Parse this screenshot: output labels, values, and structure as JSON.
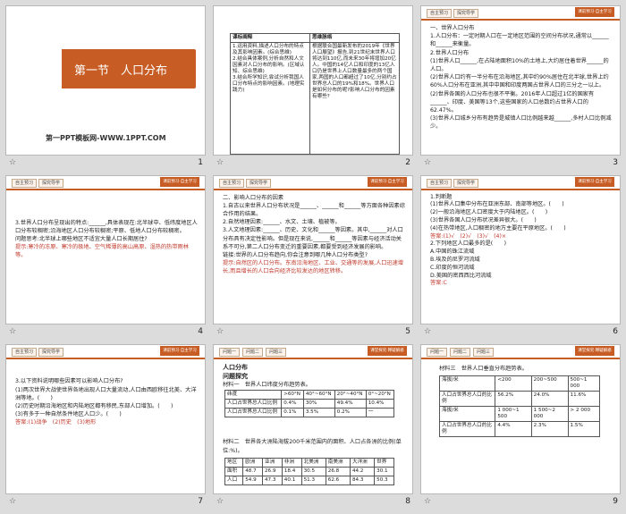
{
  "slides": [
    {
      "num": "1",
      "title": "第一节　人口分布",
      "footer": "第一PPT模板网-WWW.1PPT.COM",
      "accent": "#c75c24"
    },
    {
      "num": "2",
      "col1_head": "课标阐释",
      "col1": "1.运用资料,描述人口分布的特点及其影响因素。(综合思维)\n2.结合具体案例,分析自然和人文因素对人口分布的影响。(区域认知、综合思维)\n3.结合所学知识,尝试分析我国人口分布特点的影响因素。(地理实践力)",
      "col2_head": "思维脉络",
      "col2": "根据联合国最新发布的2019年《世界人口展望》报告,到21世纪末世界人口将达到110亿,而未来30年将增加20亿人。中国的14亿人口和印度的13亿人口仍是世界上人口数量最多的两个国家,两国的人口都超过了10亿,分别约占世界总人口的19%和18%。世界人口是如何分布的呢?影响人口分布的因素有哪些?"
    },
    {
      "num": "3",
      "chips": [
        "自主预习",
        "探究导学"
      ],
      "logo": "课前预习·自主学习",
      "lines": [
        "一、世界人口分布",
        "1.人口分布：一定时期人口在一定地区范围的空间分布状况,通常以______和______来衡量。",
        "2.世界人口分布",
        "(1)世界人口______,在占陆地面积10%的土地上,大约居住着世界______的人口。",
        "(2)世界人口约有一半分布在沿海地区,其中约90%居住在北半球,世界上约60%人口分布在亚洲,其中中国和印度两国占世界人口的三分之一以上。",
        "(2)世界各国的人口分布也很不平衡。2016年人口超过1亿的国家有______、印度、美国等13个,这些国家的人口总数约占世界人口的62.47%。",
        "(3)世界人口城乡分布有趋势是城镇人口比例越来越______,多村人口比例减少。"
      ]
    },
    {
      "num": "4",
      "chips": [
        "自主预习",
        "探究导学"
      ],
      "logo": "课前预习·自主学习",
      "lines": [
        "3.世界人口分布呈现出的特点:______,具体表现在:北半球中、低纬度地区人口分布较稠密;沿海地区人口分布较稠密;平原、低地人口分布较稠密。",
        "问题思考:北半球上哪些地区不适宜大量人口长期居住?",
        "提示:寒冷的冻原、寒冷的极地、空气稀薄的高山高原、湿热的热带雨林等。"
      ]
    },
    {
      "num": "5",
      "chips": [
        "自主预习",
        "探究导学"
      ],
      "logo": "课前预习·自主学习",
      "lines": [
        "二、影响人口分布的因素",
        "1.自古以来世界人口分布状况是______、______和______等方面各种因素综合作用的结果。",
        "2.自然地理因素:______、水文、土壤、植被等。",
        "3.人文地理因素:______、历史、文化和______等因素。其中,______对人口分布具有决定性影响。但是现在来说,______和______等因素与经济活动关系不可分,第二人口分布变迁的重要因素,都要受到经济发展的影响。",
        "链接:世界的人口分布趋向,你会注意到哪几种人口分布类型?",
        "提示:自然区的人口分布。东南沿海地区、工业、交通等的发展,人口迅速增长,而且增长的人口会向经济比较发达的地区转移。"
      ]
    },
    {
      "num": "6",
      "chips": [
        "自主预习",
        "探究导学"
      ],
      "logo": "课前预习·自主学习",
      "lines": [
        "1.判断题",
        "(1)世界人口集中分布在亚洲东部、南部等地区。(　　)",
        "(2)一般沿海地区人口密度大于内陆地区。(　　)",
        "(3)世界各国人口分布状况差异很大。(　　)",
        "(4)在热带地区,人口稠密的地方主要在平原地区。(　　)",
        "答案:(1)√　(2)√　(3)√　(4)×",
        "2.下列地区人口最多的是(　　)",
        "A.中国的珠江流域",
        "B.埃及的尼罗河流域",
        "C.印度的恒河流域",
        "D.美国的密西西比河流域",
        "答案:C"
      ]
    },
    {
      "num": "7",
      "chips": [
        "自主预习",
        "探究导学"
      ],
      "logo": "课前预习·自主学习",
      "lines": [
        "3.以下资料说明哪些因素可以影响人口分布?",
        "(1)两次世界大战使世界各地出现人口大量流动,人口由西欧移往北美、大洋洲等地。(　　)",
        "(2)历史时期沿海地区和内陆地区都有移民,东部人口增加。(　　)",
        "(3)有多于一种自然条件地区人口少。(　　)",
        "答案:(1)战争　(2)历史　(3)地形"
      ]
    },
    {
      "num": "8",
      "chips": [
        "问题一",
        "问题二",
        "问题三"
      ],
      "logo": "课堂探究·释疑解惑",
      "head": "人口分布",
      "sub": "问题探究",
      "mat1": "材料一　世界人口纬度分布趋势表。",
      "t1_head": [
        "纬度",
        ">60°N",
        "40°~60°N",
        "20°~40°N",
        "0°~20°N"
      ],
      "t1_rows": [
        [
          "人口占世界总人口比例",
          "0.4%",
          "30%",
          "49.4%",
          "10.4%"
        ],
        [
          "人口占世界总人口比例",
          "0.1%",
          "3.5%",
          "0.2%",
          "一"
        ]
      ],
      "mat2": "材料二　世界各大洲陆海拔200千米范围内的面积、人口占各洲的比例(单位:%)。",
      "t2_head": [
        "地区",
        "欧洲",
        "亚洲",
        "非洲",
        "北美洲",
        "南美洲",
        "大洋洲",
        "世界"
      ],
      "t2_rows": [
        [
          "面积",
          "48.7",
          "26.9",
          "18.4",
          "30.5",
          "26.8",
          "44.2",
          "30.1"
        ],
        [
          "人口",
          "54.9",
          "47.3",
          "40.1",
          "51.3",
          "62.6",
          "84.3",
          "50.3"
        ]
      ]
    },
    {
      "num": "9",
      "chips": [
        "问题一",
        "问题二",
        "问题三"
      ],
      "logo": "课堂探究·释疑解惑",
      "mat": "材料三　世界人口垂直分布趋势表。",
      "t_rows": [
        [
          "海拔/米",
          "<200",
          "200~500",
          "500~1 000"
        ],
        [
          "人口占世界总人口的比例",
          "56.2%",
          "24.0%",
          "11.6%"
        ],
        [
          "海拔/米",
          "1 000~1 500",
          "1 500~2 000",
          "> 2 000"
        ],
        [
          "人口占世界总人口的比例",
          "4.4%",
          "2.3%",
          "1.5%"
        ]
      ]
    }
  ]
}
